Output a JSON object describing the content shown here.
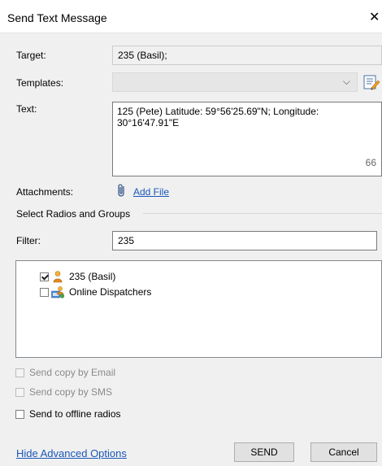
{
  "window": {
    "title": "Send Text Message",
    "close_glyph": "✕"
  },
  "form": {
    "target_label": "Target:",
    "target_value": "235 (Basil);",
    "templates_label": "Templates:",
    "templates_selected": "",
    "text_label": "Text:",
    "text_value": "125 (Pete) Latitude: 59°56'25.69\"N; Longitude: 30°16'47.91\"E",
    "char_count": "66",
    "attachments_label": "Attachments:",
    "add_file_label": "Add File",
    "group_header": "Select Radios and Groups",
    "filter_label": "Filter:",
    "filter_value": "235"
  },
  "radios": [
    {
      "label": "235 (Basil)",
      "checked": true,
      "icon": "user-icon"
    },
    {
      "label": "Online Dispatchers",
      "checked": false,
      "icon": "group-icon"
    }
  ],
  "options": {
    "email_label": "Send copy by Email",
    "sms_label": "Send copy by SMS",
    "offline_label": "Send to offline radios"
  },
  "footer": {
    "advanced_link": "Hide Advanced Options",
    "send_label": "SEND",
    "cancel_label": "Cancel"
  }
}
